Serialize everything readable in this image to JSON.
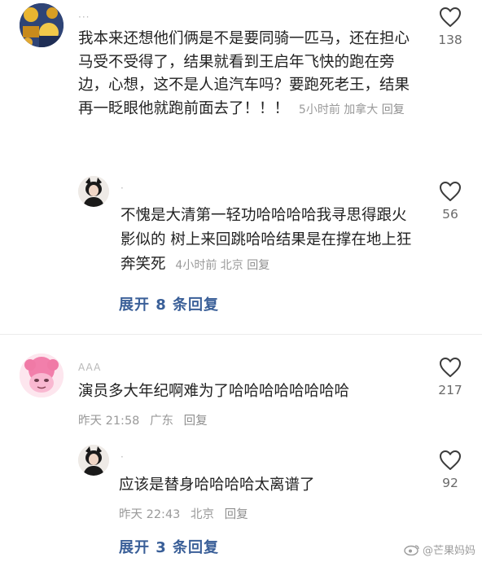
{
  "comments": [
    {
      "username": "···",
      "text": "我本来还想他们俩是不是要同骑一匹马，还在担心马受不受得了，结果就看到王启年飞快的跑在旁边，心想，这不是人追汽车吗？要跑死老王，结果再一眨眼他就跑前面去了！！！",
      "time": "5小时前",
      "location": "加拿大",
      "reply_label": "回复",
      "likes": "138",
      "reply": {
        "username": "·",
        "text": "不愧是大清第一轻功哈哈哈哈我寻思得跟火影似的 树上来回跳哈哈结果是在撑在地上狂奔笑死",
        "time": "4小时前",
        "location": "北京",
        "reply_label": "回复",
        "likes": "56"
      },
      "expand_label": "展开 8 条回复"
    },
    {
      "username": "AAA",
      "text": "演员多大年纪啊难为了哈哈哈哈哈哈哈哈",
      "time": "昨天 21:58",
      "location": "广东",
      "reply_label": "回复",
      "likes": "217",
      "reply": {
        "username": "·",
        "text": "应该是替身哈哈哈哈太离谱了",
        "time": "昨天 22:43",
        "location": "北京",
        "reply_label": "回复",
        "likes": "92"
      },
      "expand_label": "展开 3 条回复"
    }
  ],
  "watermark": "@芒果妈妈",
  "colors": {
    "link": "#3a5f98",
    "meta": "#9a9a9a",
    "text": "#222222"
  }
}
